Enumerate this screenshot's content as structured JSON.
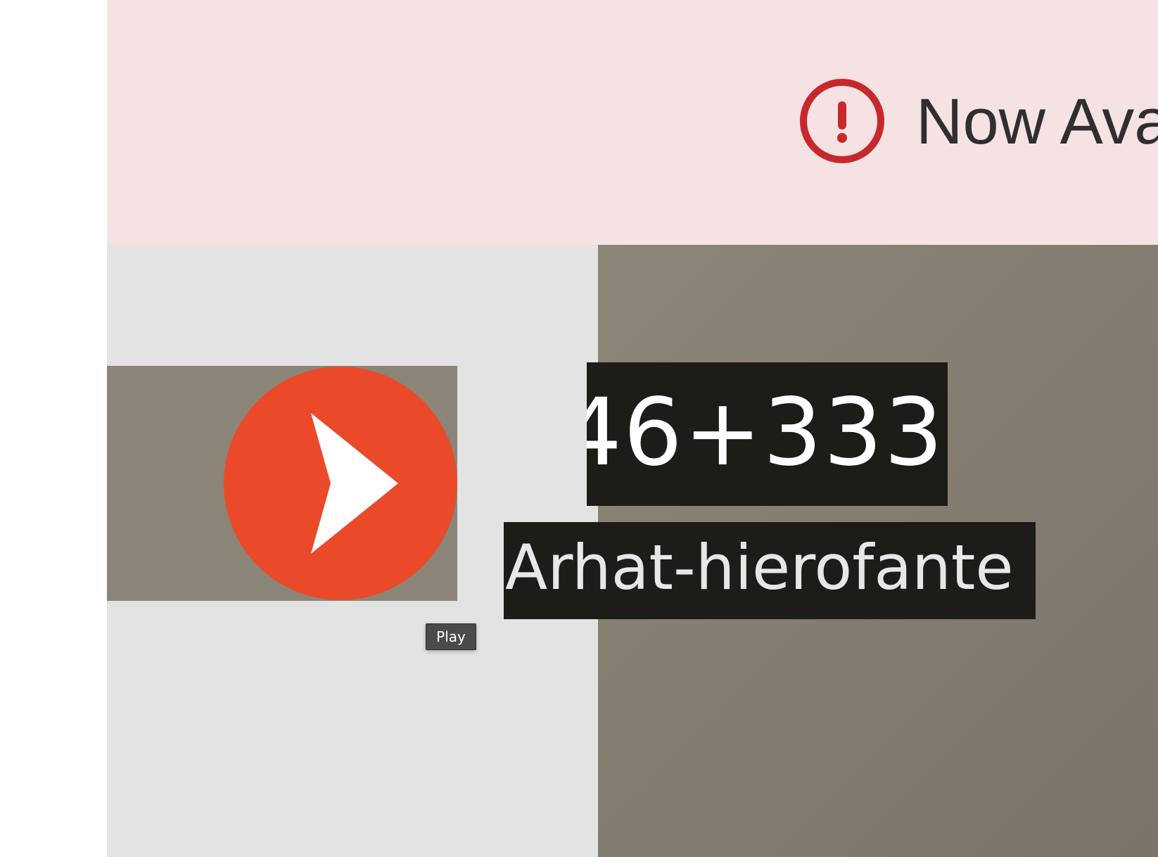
{
  "banner": {
    "icon": "alert-circle-icon",
    "icon_color": "#c6282d",
    "text": "Now Ava"
  },
  "player": {
    "play_icon": "play-arrow-icon",
    "play_button_color": "#ea4a2a",
    "tooltip": "Play"
  },
  "card": {
    "score": "46+333",
    "name": "Arhat-hierofante"
  }
}
